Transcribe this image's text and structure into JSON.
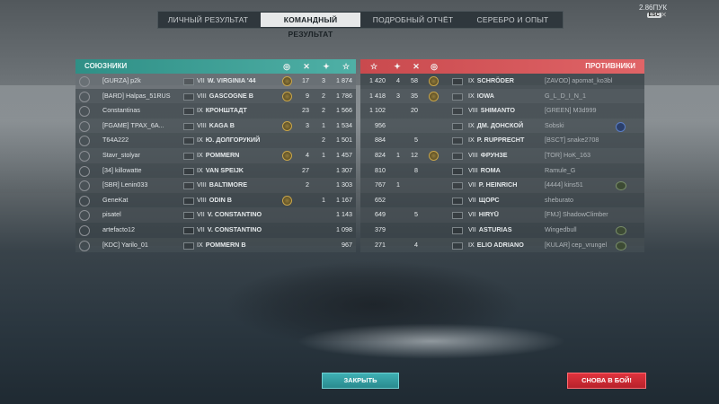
{
  "account": {
    "credits": "2.86ПУК",
    "esc": "ESC"
  },
  "tabs": [
    "ЛИЧНЫЙ РЕЗУЛЬТАТ",
    "КОМАНДНЫЙ РЕЗУЛЬТАТ",
    "ПОДРОБНЫЙ ОТЧЁТ",
    "СЕРЕБРО И ОПЫТ"
  ],
  "allies": {
    "title": "СОЮЗНИКИ",
    "rows": [
      {
        "player": "[GURZA] p2k",
        "tier": "VII",
        "ship": "W. VIRGINIA '44",
        "frags": "17",
        "kills": "3",
        "score": "1 874",
        "medal": true,
        "me": true
      },
      {
        "player": "[BARD] Halpas_51RUS",
        "tier": "VIII",
        "ship": "GASCOGNE B",
        "frags": "9",
        "kills": "2",
        "score": "1 786",
        "medal": true
      },
      {
        "player": "Constantinas",
        "tier": "IX",
        "ship": "КРОНШТАДТ",
        "frags": "23",
        "kills": "2",
        "score": "1 566",
        "medal": false
      },
      {
        "player": "[FGAME] ТРАХ_6А...",
        "tier": "VIII",
        "ship": "KAGA B",
        "frags": "3",
        "kills": "1",
        "score": "1 534",
        "medal": true
      },
      {
        "player": "T64A222",
        "tier": "IX",
        "ship": "Ю. ДОЛГОРУКИЙ",
        "frags": "",
        "kills": "2",
        "score": "1 501",
        "medal": false
      },
      {
        "player": "Stavr_stolyar",
        "tier": "IX",
        "ship": "POMMERN",
        "frags": "4",
        "kills": "1",
        "score": "1 457",
        "medal": true
      },
      {
        "player": "[34] killowatte",
        "tier": "IX",
        "ship": "VAN SPEIJK",
        "frags": "27",
        "kills": "",
        "score": "1 307",
        "medal": false
      },
      {
        "player": "[SBR] Lenin033",
        "tier": "VIII",
        "ship": "BALTIMORE",
        "frags": "2",
        "kills": "",
        "score": "1 303",
        "medal": false
      },
      {
        "player": "GeneKat",
        "tier": "VIII",
        "ship": "ODIN B",
        "frags": "",
        "kills": "1",
        "score": "1 167",
        "medal": true
      },
      {
        "player": "pisatel",
        "tier": "VII",
        "ship": "V. CONSTANTINO",
        "frags": "",
        "kills": "",
        "score": "1 143",
        "medal": false
      },
      {
        "player": "artefacto12",
        "tier": "VII",
        "ship": "V. CONSTANTINO",
        "frags": "",
        "kills": "",
        "score": "1 098",
        "medal": false
      },
      {
        "player": "[KDC] Yarilo_01",
        "tier": "IX",
        "ship": "POMMERN B",
        "frags": "",
        "kills": "",
        "score": "967",
        "medal": false
      }
    ]
  },
  "enemies": {
    "title": "ПРОТИВНИКИ",
    "rows": [
      {
        "score": "1 420",
        "kills": "4",
        "frags": "58",
        "tier": "IX",
        "ship": "SCHRÖDER",
        "player": "[ZAVOD] apomat_ko3bl",
        "medal": true
      },
      {
        "score": "1 418",
        "kills": "3",
        "frags": "35",
        "tier": "IX",
        "ship": "IOWA",
        "player": "G_L_D_I_N_1",
        "medal": true
      },
      {
        "score": "1 102",
        "kills": "",
        "frags": "20",
        "tier": "VIII",
        "ship": "SHIMANTO",
        "player": "[GREEN] M3d999",
        "medal": false
      },
      {
        "score": "956",
        "kills": "",
        "frags": "",
        "tier": "IX",
        "ship": "ДМ. ДОНСКОЙ",
        "player": "Sobski",
        "medal": false
      },
      {
        "score": "884",
        "kills": "",
        "frags": "5",
        "tier": "IX",
        "ship": "P. RUPPRECHT",
        "player": "[BSCT] snake2708",
        "medal": false
      },
      {
        "score": "824",
        "kills": "1",
        "frags": "12",
        "tier": "VIII",
        "ship": "ФРУНЗЕ",
        "player": "[TOR] HoK_163",
        "medal": true
      },
      {
        "score": "810",
        "kills": "",
        "frags": "8",
        "tier": "VIII",
        "ship": "ROMA",
        "player": "Ramule_G",
        "medal": false
      },
      {
        "score": "767",
        "kills": "1",
        "frags": "",
        "tier": "VII",
        "ship": "P. HEINRICH",
        "player": "[4444] kins51",
        "medal": false
      },
      {
        "score": "652",
        "kills": "",
        "frags": "",
        "tier": "VII",
        "ship": "ЩОРС",
        "player": "sheburato",
        "medal": false
      },
      {
        "score": "649",
        "kills": "",
        "frags": "5",
        "tier": "VII",
        "ship": "HIRYŪ",
        "player": "[FMJ] ShadowClimber",
        "medal": false
      },
      {
        "score": "379",
        "kills": "",
        "frags": "",
        "tier": "VII",
        "ship": "ASTURIAS",
        "player": "Wingedbull",
        "medal": false
      },
      {
        "score": "271",
        "kills": "",
        "frags": "4",
        "tier": "IX",
        "ship": "ELIO ADRIANO",
        "player": "[KULAR] cep_vrungel",
        "medal": false
      }
    ]
  },
  "buttons": {
    "close": "ЗАКРЫТЬ",
    "again": "СНОВА В БОЙ!"
  },
  "colors": {
    "allies": "#4fb0a6",
    "enemies": "#e06467",
    "close_btn": "#3fb0b4",
    "again_btn": "#e0333d"
  }
}
